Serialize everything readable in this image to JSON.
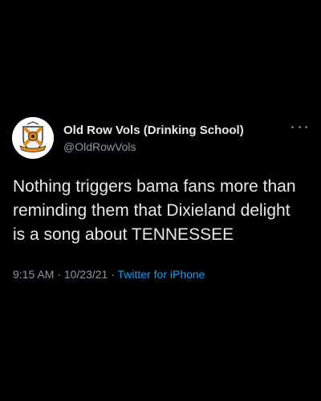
{
  "tweet": {
    "author": {
      "display_name": "Old Row Vols (Drinking School)",
      "handle": "@OldRowVols",
      "avatar_icon": "crest-logo-icon"
    },
    "more_icon": "more-options-icon",
    "text": "Nothing triggers bama fans more than\nreminding them that Dixieland delight\nis a song about TENNESSEE",
    "time": "9:15 AM",
    "date": "10/23/21",
    "separator": "·",
    "source": "Twitter for iPhone"
  },
  "colors": {
    "background": "#000000",
    "text": "#e7e9ea",
    "secondary": "#8b98a5",
    "link": "#1d9bf0",
    "crest_orange": "#e08a1e"
  }
}
